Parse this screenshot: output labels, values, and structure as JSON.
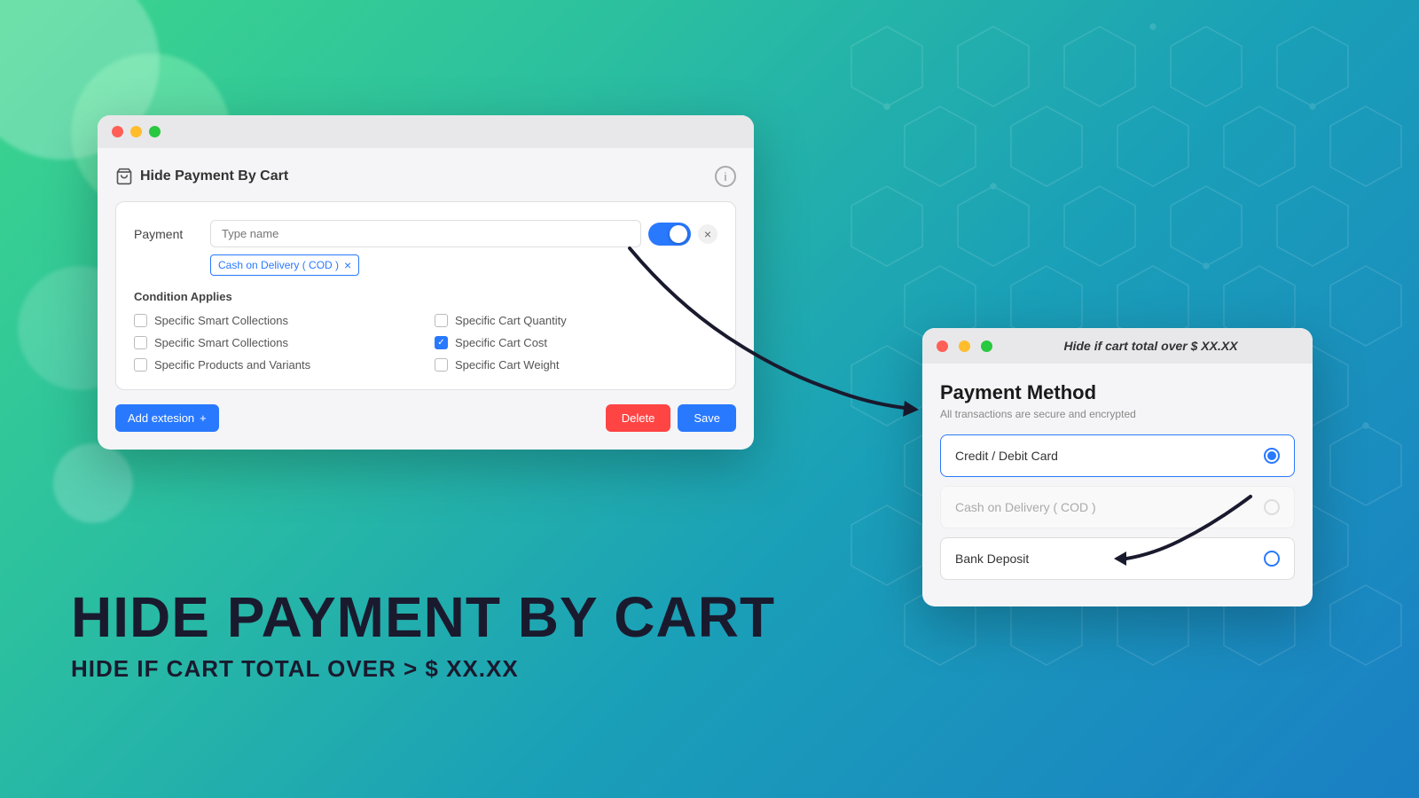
{
  "background": {
    "gradient_start": "#3dd68c",
    "gradient_end": "#1a7fc4"
  },
  "left_text": {
    "main_title": "HIDE PAYMENT BY CART",
    "sub_title": "HIDE IF CART TOTAL OVER > $ XX.XX"
  },
  "admin_window": {
    "title": "Hide Payment By Cart",
    "info_icon_label": "i",
    "titlebar": {
      "dots": [
        "red",
        "yellow",
        "green"
      ]
    },
    "payment_section": {
      "label": "Payment",
      "input_placeholder": "Type name",
      "toggle_state": "on",
      "close_label": "×",
      "cod_tag": "Cash on Delivery ( COD )",
      "cod_tag_x": "×"
    },
    "condition_applies": {
      "title": "Condition Applies",
      "items_left": [
        {
          "label": "Specific Smart Collections",
          "checked": false
        },
        {
          "label": "Specific Smart Collections",
          "checked": false
        },
        {
          "label": "Specific Products and Variants",
          "checked": false
        }
      ],
      "items_right": [
        {
          "label": "Specific Cart Quantity",
          "checked": false
        },
        {
          "label": "Specific Cart Cost",
          "checked": true
        },
        {
          "label": "Specific Cart Weight",
          "checked": false
        }
      ]
    },
    "footer": {
      "add_extension_label": "Add extesion",
      "add_icon": "+",
      "delete_label": "Delete",
      "save_label": "Save"
    }
  },
  "payment_window": {
    "hint_text": "Hide if cart total over $ XX.XX",
    "title": "Payment Method",
    "secure_text": "All transactions are secure and encrypted",
    "options": [
      {
        "label": "Credit / Debit Card",
        "state": "selected"
      },
      {
        "label": "Cash on Delivery ( COD )",
        "state": "disabled"
      },
      {
        "label": "Bank Deposit",
        "state": "normal"
      }
    ]
  }
}
